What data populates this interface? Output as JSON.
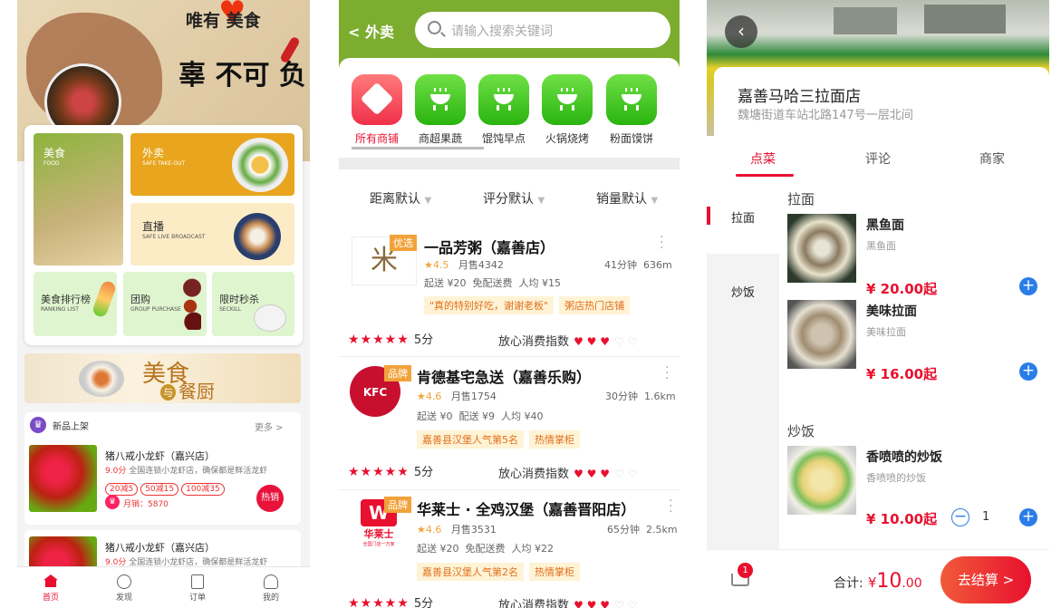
{
  "phone1": {
    "banner": {
      "calligraphy_top": "唯有 美食",
      "calligraphy_main": "辜 不可 负"
    },
    "tiles": [
      {
        "title": "美食",
        "subtitle": "FOOD"
      },
      {
        "title": "外卖",
        "subtitle": "SAFE TAKE-OUT"
      },
      {
        "title": "直播",
        "subtitle": "SAFE LIVE BROADCAST"
      },
      {
        "title": "美食排行榜",
        "subtitle": "RANKING LIST"
      },
      {
        "title": "团购",
        "subtitle": "GROUP PURCHASE"
      },
      {
        "title": "限时秒杀",
        "subtitle": "SECKILL"
      }
    ],
    "promo": {
      "text1": "美食",
      "text2": "与",
      "text3": "餐厨"
    },
    "new_section": {
      "title": "新品上架",
      "more": "更多 >"
    },
    "items": [
      {
        "name": "猪八戒小龙虾（嘉兴店）",
        "score": "9.0分",
        "desc": "全国连锁小龙虾店，确保都是鲜活龙虾",
        "coupons": [
          "20减5",
          "50减15",
          "100减35"
        ],
        "sales": "月销：5870",
        "badge": "热销"
      },
      {
        "name": "猪八戒小龙虾（嘉兴店）",
        "score": "9.0分",
        "desc": "全国连锁小龙虾店，确保都是鲜活龙虾"
      }
    ],
    "tabs": [
      {
        "label": "首页",
        "icon": "home-icon"
      },
      {
        "label": "发现",
        "icon": "compass-icon"
      },
      {
        "label": "订单",
        "icon": "order-icon"
      },
      {
        "label": "我的",
        "icon": "user-icon"
      }
    ]
  },
  "phone2": {
    "back_label": "< 外卖",
    "search_placeholder": "请输入搜索关键词",
    "categories": [
      "所有商铺",
      "商超果蔬",
      "馄饨早点",
      "火锅烧烤",
      "粉面馍饼"
    ],
    "sorts": [
      "距离默认",
      "评分默认",
      "销量默认"
    ],
    "stores": [
      {
        "name": "一品芳粥（嘉善店）",
        "badge": "优选",
        "rating": "4.5",
        "sales": "月售4342",
        "time": "41分钟",
        "distance": "636m",
        "fees": "起送 ¥20  免配送费  人均 ¥15",
        "tags": [
          "\"真的特别好吃，谢谢老板\"",
          "粥店热门店铺"
        ],
        "score": "5分",
        "trust": "放心消费指数",
        "logo": "米"
      },
      {
        "name": "肯德基宅急送（嘉善乐购）",
        "badge": "品牌",
        "rating": "4.6",
        "sales": "月售1754",
        "time": "30分钟",
        "distance": "1.6km",
        "fees": "起送 ¥0  配送 ¥9  人均 ¥40",
        "tags": [
          "嘉善县汉堡人气第5名",
          "热情掌柜"
        ],
        "score": "5分",
        "trust": "放心消费指数",
        "logo": "KFC"
      },
      {
        "name": "华莱士 · 全鸡汉堡（嘉善晋阳店）",
        "badge": "品牌",
        "rating": "4.6",
        "sales": "月售3531",
        "time": "65分钟",
        "distance": "2.5km",
        "fees": "起送 ¥20  免配送费  人均 ¥22",
        "tags": [
          "嘉善县汉堡人气第2名",
          "热情掌柜"
        ],
        "score": "5分",
        "trust": "放心消费指数",
        "logo": "华莱士",
        "logo_sub": "全国门店一万家"
      }
    ]
  },
  "phone3": {
    "shop_name": "嘉善马哈三拉面店",
    "address": "魏塘街道车站北路147号一层北间",
    "tabs": [
      "点菜",
      "评论",
      "商家"
    ],
    "side_categories": [
      "拉面",
      "炒饭"
    ],
    "sections": [
      {
        "title": "拉面",
        "items": [
          {
            "name": "黑鱼面",
            "desc": "黑鱼面",
            "price": "¥ 20.00起"
          },
          {
            "name": "美味拉面",
            "desc": "美味拉面",
            "price": "¥ 16.00起"
          }
        ]
      },
      {
        "title": "炒饭",
        "items": [
          {
            "name": "香喷喷的炒饭",
            "desc": "香喷喷的炒饭",
            "price": "¥ 10.00起",
            "qty": "1"
          }
        ]
      }
    ],
    "cart_count": "1",
    "total_label": "合计:",
    "total_currency": "¥",
    "total_int": "10",
    "total_dec": ".00",
    "checkout": "去结算 >"
  }
}
